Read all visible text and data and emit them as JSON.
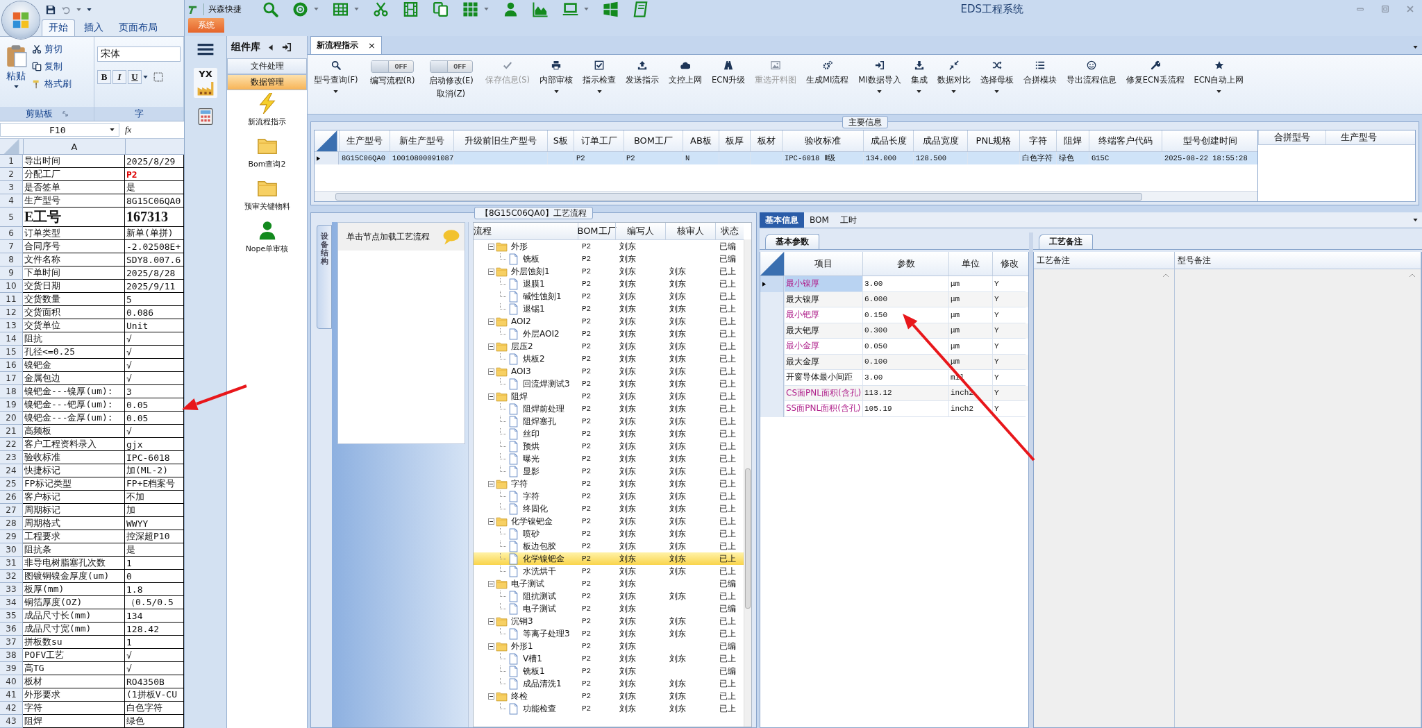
{
  "excel": {
    "ribbon_tabs": [
      {
        "label": "开始",
        "selected": true
      },
      {
        "label": "插入",
        "selected": false
      },
      {
        "label": "页面布局",
        "selected": false
      }
    ],
    "clipboard": {
      "paste": "粘贴",
      "cut": "剪切",
      "copy": "复制",
      "format_painter": "格式刷",
      "group_label": "剪贴板"
    },
    "font": {
      "name": "宋体",
      "buttons": [
        "B",
        "I",
        "U"
      ],
      "group_label": "字"
    },
    "name_box": "F10",
    "formula_label": "fx",
    "column_header": "A",
    "rows": [
      {
        "num": "1",
        "label": "导出时间",
        "value": "2025/8/29",
        "kind": "text"
      },
      {
        "num": "2",
        "label": "分配工厂",
        "value": "P2",
        "kind": "alert"
      },
      {
        "num": "3",
        "label": "是否签单",
        "value": "是",
        "kind": "text"
      },
      {
        "num": "4",
        "label": "生产型号",
        "value": "8G15C06QA0",
        "kind": "text"
      },
      {
        "num": "5",
        "label": "E工号",
        "value": "167313",
        "kind": "title"
      },
      {
        "num": "6",
        "label": "订单类型",
        "value": "新单(单拼)",
        "kind": "text"
      },
      {
        "num": "7",
        "label": "合同序号",
        "value": "-2.02508E+",
        "kind": "text"
      },
      {
        "num": "8",
        "label": "文件名称",
        "value": "SDY8.007.6",
        "kind": "text"
      },
      {
        "num": "9",
        "label": "下单时间",
        "value": "2025/8/28",
        "kind": "text"
      },
      {
        "num": "10",
        "label": "交货日期",
        "value": "2025/9/11",
        "kind": "text"
      },
      {
        "num": "11",
        "label": "交货数量",
        "value": "5",
        "kind": "text"
      },
      {
        "num": "12",
        "label": "交货面积",
        "value": "0.086",
        "kind": "text"
      },
      {
        "num": "13",
        "label": "交货单位",
        "value": "Unit",
        "kind": "text"
      },
      {
        "num": "14",
        "label": "阻抗",
        "value": "√",
        "kind": "text"
      },
      {
        "num": "15",
        "label": "孔径<=0.25",
        "value": "√",
        "kind": "text"
      },
      {
        "num": "16",
        "label": "镍钯金",
        "value": "√",
        "kind": "text"
      },
      {
        "num": "17",
        "label": "金属包边",
        "value": "√",
        "kind": "text"
      },
      {
        "num": "18",
        "label": "镍钯金---镍厚(um):",
        "value": "3",
        "kind": "text"
      },
      {
        "num": "19",
        "label": "镍钯金---钯厚(um):",
        "value": "0.05",
        "kind": "text"
      },
      {
        "num": "20",
        "label": "镍钯金---金厚(um):",
        "value": "0.05",
        "kind": "text"
      },
      {
        "num": "21",
        "label": "高频板",
        "value": "√",
        "kind": "text"
      },
      {
        "num": "22",
        "label": "客户工程资料录入",
        "value": "gjx",
        "kind": "text"
      },
      {
        "num": "23",
        "label": "验收标准",
        "value": "IPC-6018",
        "kind": "text"
      },
      {
        "num": "24",
        "label": "快捷标记",
        "value": "加(ML-2)",
        "kind": "text"
      },
      {
        "num": "25",
        "label": "FP标记类型",
        "value": "FP+E档案号",
        "kind": "text"
      },
      {
        "num": "26",
        "label": "客户标记",
        "value": "不加",
        "kind": "text"
      },
      {
        "num": "27",
        "label": "周期标记",
        "value": "加",
        "kind": "text"
      },
      {
        "num": "28",
        "label": "周期格式",
        "value": "WWYY",
        "kind": "text"
      },
      {
        "num": "29",
        "label": "工程要求",
        "value": "控深超P10",
        "kind": "text"
      },
      {
        "num": "30",
        "label": "阻抗条",
        "value": "是",
        "kind": "text"
      },
      {
        "num": "31",
        "label": "非导电树脂塞孔次数",
        "value": "1",
        "kind": "text"
      },
      {
        "num": "32",
        "label": "图镀铜镍金厚度(um)",
        "value": "0",
        "kind": "text"
      },
      {
        "num": "33",
        "label": "板厚(mm)",
        "value": "1.8",
        "kind": "text"
      },
      {
        "num": "34",
        "label": "铜箔厚度(OZ)",
        "value": "（0.5/0.5",
        "kind": "text"
      },
      {
        "num": "35",
        "label": "成品尺寸长(mm)",
        "value": "134",
        "kind": "text"
      },
      {
        "num": "36",
        "label": "成品尺寸宽(mm)",
        "value": "128.42",
        "kind": "text"
      },
      {
        "num": "37",
        "label": "拼板数su",
        "value": "1",
        "kind": "text"
      },
      {
        "num": "38",
        "label": "POFV工艺",
        "value": "√",
        "kind": "text"
      },
      {
        "num": "39",
        "label": "高TG",
        "value": "√",
        "kind": "text"
      },
      {
        "num": "40",
        "label": "板材",
        "value": "RO4350B",
        "kind": "text"
      },
      {
        "num": "41",
        "label": "外形要求",
        "value": "(1拼板V-CU",
        "kind": "text"
      },
      {
        "num": "42",
        "label": "字符",
        "value": "白色字符",
        "kind": "text"
      },
      {
        "num": "43",
        "label": "阻焊",
        "value": "绿色",
        "kind": "text"
      }
    ]
  },
  "app": {
    "quick_label": "兴森快捷",
    "title": "EDS工程系统",
    "system_tab": "系统",
    "nav_badge": "YX",
    "library": {
      "title": "组件库",
      "categories": [
        {
          "label": "文件处理",
          "selected": false
        },
        {
          "label": "数据管理",
          "selected": true
        }
      ],
      "items": [
        {
          "label": "新流程指示"
        },
        {
          "label": "Bom查询2"
        },
        {
          "label": "预审关键物料"
        },
        {
          "label": "Nope单审核"
        }
      ]
    },
    "doc_tab": {
      "label": "新流程指示",
      "close": "×"
    },
    "toolbar": [
      {
        "kind": "button",
        "label": "型号查询(F)",
        "dropdown": true,
        "disabled": false
      },
      {
        "kind": "toggle",
        "label": "编写流程(R)",
        "toggle_text": "OFF",
        "on": false
      },
      {
        "kind": "toggle",
        "label": "启动修改(E)",
        "label2": "取消(Z)",
        "toggle_text": "OFF",
        "on": false
      },
      {
        "kind": "button",
        "label": "保存信息(S)",
        "dropdown": false,
        "disabled": true
      },
      {
        "kind": "button",
        "label": "内部审核",
        "dropdown": true,
        "disabled": false
      },
      {
        "kind": "button",
        "label": "指示检查",
        "dropdown": true,
        "disabled": false
      },
      {
        "kind": "button",
        "label": "发送指示",
        "dropdown": false,
        "disabled": false
      },
      {
        "kind": "button",
        "label": "文控上网",
        "dropdown": false,
        "disabled": false
      },
      {
        "kind": "button",
        "label": "ECN升级",
        "dropdown": false,
        "disabled": false
      },
      {
        "kind": "button",
        "label": "重选开料图",
        "dropdown": false,
        "disabled": true
      },
      {
        "kind": "button",
        "label": "生成MI流程",
        "dropdown": false,
        "disabled": false
      },
      {
        "kind": "button",
        "label": "MI数据导入",
        "dropdown": true,
        "disabled": false
      },
      {
        "kind": "button",
        "label": "集成",
        "dropdown": true,
        "disabled": false
      },
      {
        "kind": "button",
        "label": "数据对比",
        "dropdown": true,
        "disabled": false
      },
      {
        "kind": "button",
        "label": "选择母板",
        "dropdown": true,
        "disabled": false
      },
      {
        "kind": "button",
        "label": "合拼模块",
        "dropdown": false,
        "disabled": false
      },
      {
        "kind": "button",
        "label": "导出流程信息",
        "dropdown": false,
        "disabled": false
      },
      {
        "kind": "button",
        "label": "修复ECN丢流程",
        "dropdown": false,
        "disabled": false
      },
      {
        "kind": "button",
        "label": "ECN自动上网",
        "dropdown": true,
        "disabled": false
      }
    ],
    "main_info": {
      "title": "主要信息",
      "columns": [
        "生产型号",
        "新生产型号",
        "升级前旧生产型号",
        "S板",
        "订单工厂",
        "BOM工厂",
        "AB板",
        "板厚",
        "板材",
        "验收标准",
        "成品长度",
        "成品宽度",
        "PNL规格",
        "字符",
        "阻焊",
        "终端客户代码",
        "型号创建时间"
      ],
      "rows": [
        {
          "selected": true,
          "cells": [
            "8G15C06QA0",
            "10010800091087",
            null,
            null,
            "P2",
            "P2",
            "N",
            null,
            null,
            "IPC-6018 Ⅱ级",
            "134.000",
            "128.500",
            null,
            "白色字符",
            "绿色",
            "G15C",
            "2025-08-22 18:55:28"
          ]
        }
      ],
      "side_columns": [
        "合拼型号",
        "生产型号"
      ]
    },
    "process": {
      "title": "【8G15C06QA0】工艺流程",
      "side_tab": "设备结构",
      "hint": "单击节点加载工艺流程",
      "columns": [
        "流程",
        "BOM工厂",
        "编写人",
        "核审人",
        "状态"
      ],
      "tree": [
        {
          "label": "外形",
          "bom": "P2",
          "author": "刘东",
          "status": "已编",
          "expanded": true,
          "selected": false,
          "children": [
            {
              "label": "铣板",
              "bom": "P2",
              "author": "刘东",
              "status": "已编",
              "selected": false
            }
          ]
        },
        {
          "label": "外层蚀刻1",
          "bom": "P2",
          "author": "刘东",
          "reviewer": "刘东",
          "status": "已上",
          "expanded": true,
          "selected": false,
          "children": [
            {
              "label": "退膜1",
              "bom": "P2",
              "author": "刘东",
              "reviewer": "刘东",
              "status": "已上",
              "selected": false
            },
            {
              "label": "碱性蚀刻1",
              "bom": "P2",
              "author": "刘东",
              "reviewer": "刘东",
              "status": "已上",
              "selected": false
            },
            {
              "label": "退锡1",
              "bom": "P2",
              "author": "刘东",
              "reviewer": "刘东",
              "status": "已上",
              "selected": false
            }
          ]
        },
        {
          "label": "AOI2",
          "bom": "P2",
          "author": "刘东",
          "reviewer": "刘东",
          "status": "已上",
          "expanded": true,
          "selected": false,
          "children": [
            {
              "label": "外层AOI2",
              "bom": "P2",
              "author": "刘东",
              "reviewer": "刘东",
              "status": "已上",
              "selected": false
            }
          ]
        },
        {
          "label": "层压2",
          "bom": "P2",
          "author": "刘东",
          "reviewer": "刘东",
          "status": "已上",
          "expanded": true,
          "selected": false,
          "children": [
            {
              "label": "烘板2",
              "bom": "P2",
              "author": "刘东",
              "reviewer": "刘东",
              "status": "已上",
              "selected": false
            }
          ]
        },
        {
          "label": "AOI3",
          "bom": "P2",
          "author": "刘东",
          "reviewer": "刘东",
          "status": "已上",
          "expanded": true,
          "selected": false,
          "children": [
            {
              "label": "回流焊测试3",
              "bom": "P2",
              "author": "刘东",
              "reviewer": "刘东",
              "status": "已上",
              "selected": false
            }
          ]
        },
        {
          "label": "阻焊",
          "bom": "P2",
          "author": "刘东",
          "reviewer": "刘东",
          "status": "已上",
          "expanded": true,
          "selected": false,
          "children": [
            {
              "label": "阻焊前处理",
              "bom": "P2",
              "author": "刘东",
              "reviewer": "刘东",
              "status": "已上",
              "selected": false
            },
            {
              "label": "阻焊塞孔",
              "bom": "P2",
              "author": "刘东",
              "reviewer": "刘东",
              "status": "已上",
              "selected": false
            },
            {
              "label": "丝印",
              "bom": "P2",
              "author": "刘东",
              "reviewer": "刘东",
              "status": "已上",
              "selected": false
            },
            {
              "label": "预烘",
              "bom": "P2",
              "author": "刘东",
              "reviewer": "刘东",
              "status": "已上",
              "selected": false
            },
            {
              "label": "曝光",
              "bom": "P2",
              "author": "刘东",
              "reviewer": "刘东",
              "status": "已上",
              "selected": false
            },
            {
              "label": "显影",
              "bom": "P2",
              "author": "刘东",
              "reviewer": "刘东",
              "status": "已上",
              "selected": false
            }
          ]
        },
        {
          "label": "字符",
          "bom": "P2",
          "author": "刘东",
          "reviewer": "刘东",
          "status": "已上",
          "expanded": true,
          "selected": false,
          "children": [
            {
              "label": "字符",
              "bom": "P2",
              "author": "刘东",
              "reviewer": "刘东",
              "status": "已上",
              "selected": false
            },
            {
              "label": "终固化",
              "bom": "P2",
              "author": "刘东",
              "reviewer": "刘东",
              "status": "已上",
              "selected": false
            }
          ]
        },
        {
          "label": "化学镍钯金",
          "bom": "P2",
          "author": "刘东",
          "reviewer": "刘东",
          "status": "已上",
          "expanded": true,
          "selected": false,
          "children": [
            {
              "label": "喷砂",
              "bom": "P2",
              "author": "刘东",
              "reviewer": "刘东",
              "status": "已上",
              "selected": false
            },
            {
              "label": "板边包胶",
              "bom": "P2",
              "author": "刘东",
              "reviewer": "刘东",
              "status": "已上",
              "selected": false
            },
            {
              "label": "化学镍钯金",
              "bom": "P2",
              "author": "刘东",
              "reviewer": "刘东",
              "status": "已上",
              "selected": true
            },
            {
              "label": "水洗烘干",
              "bom": "P2",
              "author": "刘东",
              "reviewer": "刘东",
              "status": "已上",
              "selected": false
            }
          ]
        },
        {
          "label": "电子测试",
          "bom": "P2",
          "author": "刘东",
          "status": "已编",
          "expanded": true,
          "selected": false,
          "children": [
            {
              "label": "阻抗测试",
              "bom": "P2",
              "author": "刘东",
              "reviewer": "刘东",
              "status": "已上",
              "selected": false
            },
            {
              "label": "电子测试",
              "bom": "P2",
              "author": "刘东",
              "status": "已编",
              "selected": false
            }
          ]
        },
        {
          "label": "沉铜3",
          "bom": "P2",
          "author": "刘东",
          "reviewer": "刘东",
          "status": "已上",
          "expanded": true,
          "selected": false,
          "children": [
            {
              "label": "等离子处理3",
              "bom": "P2",
              "author": "刘东",
              "reviewer": "刘东",
              "status": "已上",
              "selected": false
            }
          ]
        },
        {
          "label": "外形1",
          "bom": "P2",
          "author": "刘东",
          "status": "已编",
          "expanded": true,
          "selected": false,
          "children": [
            {
              "label": "V槽1",
              "bom": "P2",
              "author": "刘东",
              "reviewer": "刘东",
              "status": "已上",
              "selected": false
            },
            {
              "label": "铣板1",
              "bom": "P2",
              "author": "刘东",
              "status": "已编",
              "selected": false
            },
            {
              "label": "成品清洗1",
              "bom": "P2",
              "author": "刘东",
              "reviewer": "刘东",
              "status": "已上",
              "selected": false
            }
          ]
        },
        {
          "label": "终检",
          "bom": "P2",
          "author": "刘东",
          "reviewer": "刘东",
          "status": "已上",
          "expanded": true,
          "selected": false,
          "children": [
            {
              "label": "功能检查",
              "bom": "P2",
              "author": "刘东",
              "reviewer": "刘东",
              "status": "已上",
              "selected": false
            }
          ]
        }
      ]
    },
    "details": {
      "tabs": [
        {
          "label": "基本信息",
          "selected": true
        },
        {
          "label": "BOM",
          "selected": false
        },
        {
          "label": "工时",
          "selected": false
        }
      ],
      "params": {
        "tab": "基本参数",
        "columns": [
          "项目",
          "参数",
          "单位",
          "修改"
        ],
        "rows": [
          {
            "item": "最小镍厚",
            "value": "3.00",
            "unit": "μm",
            "modified": "Y",
            "highlighted": true,
            "selected": true
          },
          {
            "item": "最大镍厚",
            "value": "6.000",
            "unit": "μm",
            "modified": "Y",
            "highlighted": false,
            "selected": false
          },
          {
            "item": "最小钯厚",
            "value": "0.150",
            "unit": "μm",
            "modified": "Y",
            "highlighted": true,
            "selected": false
          },
          {
            "item": "最大钯厚",
            "value": "0.300",
            "unit": "μm",
            "modified": "Y",
            "highlighted": false,
            "selected": false
          },
          {
            "item": "最小金厚",
            "value": "0.050",
            "unit": "μm",
            "modified": "Y",
            "highlighted": true,
            "selected": false
          },
          {
            "item": "最大金厚",
            "value": "0.100",
            "unit": "μm",
            "modified": "Y",
            "highlighted": false,
            "selected": false
          },
          {
            "item": "开窗导体最小间距",
            "value": "3.00",
            "unit": "mil",
            "modified": "Y",
            "highlighted": false,
            "selected": false
          },
          {
            "item": "CS面PNL面积(含孔)",
            "value": "113.12",
            "unit": "inch2",
            "modified": "Y",
            "highlighted": true,
            "selected": false
          },
          {
            "item": "SS面PNL面积(含孔)",
            "value": "105.19",
            "unit": "inch2",
            "modified": "Y",
            "highlighted": true,
            "selected": false
          }
        ]
      },
      "notes": {
        "tab": "工艺备注",
        "columns": [
          "工艺备注",
          "型号备注"
        ]
      }
    }
  }
}
